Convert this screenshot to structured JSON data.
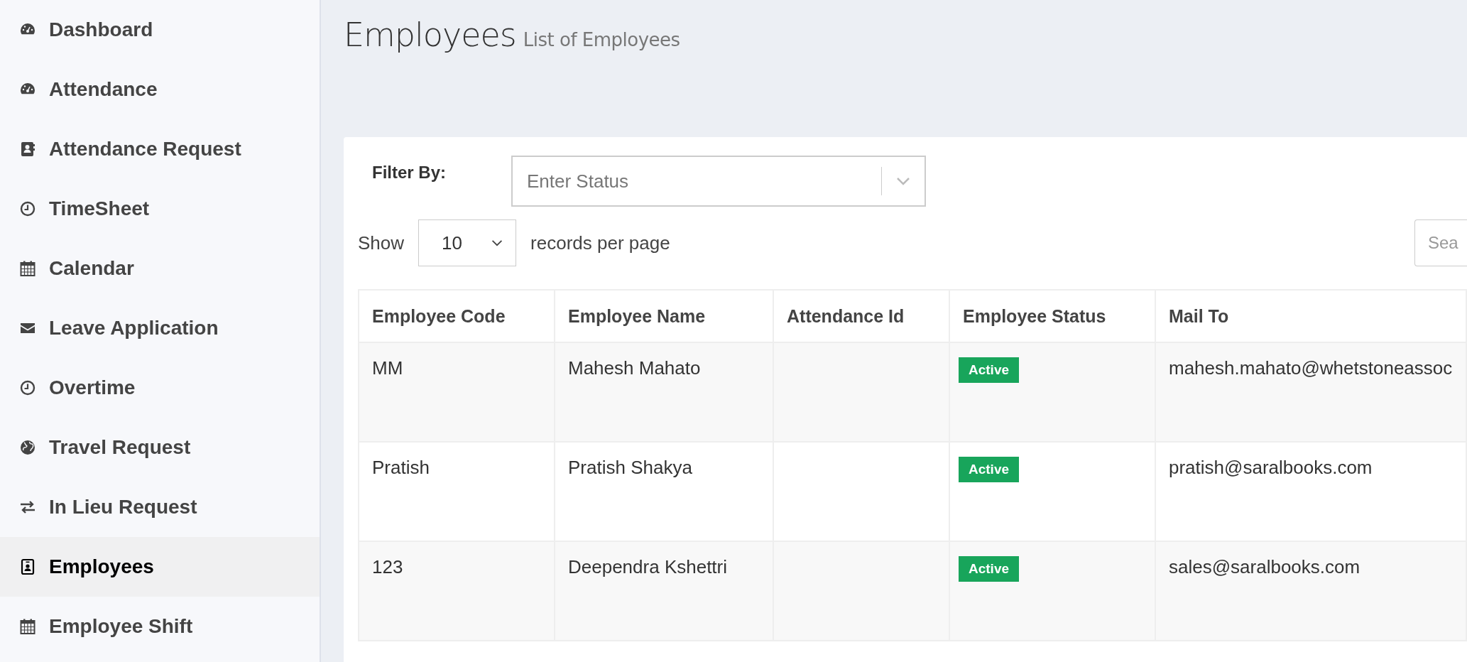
{
  "sidebar": {
    "items": [
      {
        "label": "Dashboard",
        "selected": false
      },
      {
        "label": "Attendance",
        "selected": false
      },
      {
        "label": "Attendance Request",
        "selected": false
      },
      {
        "label": "TimeSheet",
        "selected": false
      },
      {
        "label": "Calendar",
        "selected": false
      },
      {
        "label": "Leave Application",
        "selected": false
      },
      {
        "label": "Overtime",
        "selected": false
      },
      {
        "label": "Travel Request",
        "selected": false
      },
      {
        "label": "In Lieu Request",
        "selected": false
      },
      {
        "label": "Employees",
        "selected": true
      },
      {
        "label": "Employee Shift",
        "selected": false
      }
    ]
  },
  "header": {
    "title": "Employees",
    "subtitle": "List of Employees"
  },
  "filter": {
    "label": "Filter By:",
    "placeholder": "Enter Status"
  },
  "page_size": {
    "label_before": "Show",
    "value": "10",
    "label_after": "records per page"
  },
  "search": {
    "placeholder": "Sea"
  },
  "table": {
    "columns": [
      "Employee Code",
      "Employee Name",
      "Attendance Id",
      "Employee Status",
      "Mail To"
    ],
    "rows": [
      {
        "code": "MM",
        "name": "Mahesh Mahato",
        "status": "Active",
        "mail": "mahesh.mahato@whetstoneassoc"
      },
      {
        "code": "Pratish",
        "name": "Pratish Shakya",
        "status": "Active",
        "mail": "pratish@saralbooks.com"
      },
      {
        "code": "123",
        "name": "Deependra Kshettri",
        "status": "Active",
        "mail": "sales@saralbooks.com"
      }
    ]
  }
}
